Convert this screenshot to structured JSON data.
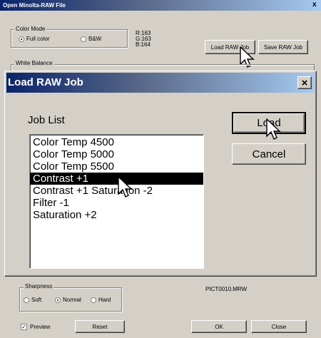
{
  "main_window": {
    "title": "Open Minolta-RAW File",
    "color_mode": {
      "label": "Color Mode",
      "options": [
        {
          "label": "Full color",
          "selected": true
        },
        {
          "label": "B&W",
          "selected": false
        }
      ]
    },
    "rgb": {
      "r": "R:163",
      "g": "G:163",
      "b": "B:164"
    },
    "load_raw_job_label": "Load RAW Job",
    "save_raw_job_label": "Save RAW Job",
    "white_balance_label": "White Balance",
    "sharpness": {
      "label": "Sharpness",
      "options": [
        {
          "label": "Soft",
          "selected": false
        },
        {
          "label": "Normal",
          "selected": true
        },
        {
          "label": "Hard",
          "selected": false
        }
      ]
    },
    "filename": "PICT0010.MRW",
    "preview_label": "Preview",
    "preview_checked": true,
    "reset_label": "Reset",
    "ok_label": "OK",
    "close_label": "Close",
    "close_glyph": "x"
  },
  "dialog": {
    "title": "Load RAW Job",
    "close_glyph": "×",
    "job_list_label": "Job List",
    "jobs": [
      "Color Temp 4500",
      "Color Temp 5000",
      "Color Temp 5500",
      "Contrast +1",
      "Contrast +1 Saturation -2",
      "Filter -1",
      "Saturation +2"
    ],
    "selected_index": 3,
    "load_label": "Load",
    "cancel_label": "Cancel"
  },
  "colors": {
    "title_gradient_start": "#0a246a",
    "title_gradient_end": "#a6caf0",
    "face": "#d4d0c8",
    "selection": "#000000"
  }
}
